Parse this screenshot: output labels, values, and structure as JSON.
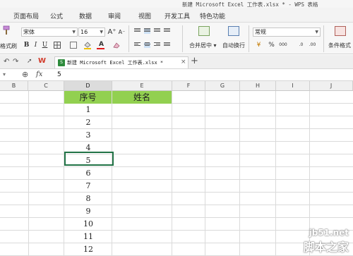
{
  "window": {
    "title": "新建 Microsoft Excel 工作表.xlsx * - WPS 表格"
  },
  "menu": {
    "items": [
      "页面布局",
      "公式",
      "数据",
      "审阅",
      "视图",
      "开发工具",
      "特色功能"
    ]
  },
  "ribbon": {
    "format_painter_label": "格式刷",
    "font_name": "宋体",
    "font_size": "16",
    "bold": "B",
    "italic": "I",
    "underline": "U",
    "font_color_glyph": "A",
    "merge_center_label": "合并居中",
    "wrap_text_label": "自动换行",
    "number_format": "常规",
    "percent_glyph": "%",
    "thousands_glyph": "000",
    "conditional_format_label": "条件格式"
  },
  "tabs": {
    "document": "新建 Microsoft Excel 工作表.xlsx *",
    "add_glyph": "+"
  },
  "formula_bar": {
    "fx_label": "fx",
    "value": "5"
  },
  "columns": [
    "B",
    "C",
    "D",
    "E",
    "F",
    "G",
    "H",
    "I",
    "J"
  ],
  "sheet": {
    "header": [
      "序号",
      "姓名"
    ],
    "numbers": [
      "1",
      "2",
      "3",
      "4",
      "5",
      "6",
      "7",
      "8",
      "9",
      "10",
      "11",
      "12"
    ],
    "active_value": "5"
  },
  "watermark": {
    "line1": "jb51.net",
    "line2": "脚本之家"
  },
  "colors": {
    "header_fill": "#92d050",
    "active_border": "#217346"
  }
}
